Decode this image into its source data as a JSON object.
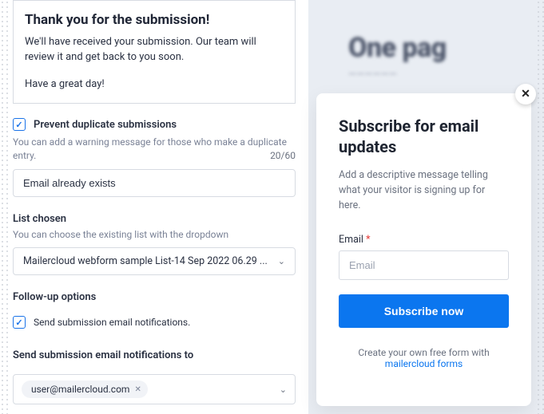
{
  "success_box": {
    "title": "Thank you for the submission!",
    "body": "We'll have received your submission. Our team will review it and get back to you soon.",
    "signoff": "Have a great day!"
  },
  "prevent": {
    "label": "Prevent duplicate submissions",
    "helper": "You can add a warning message for those who make a duplicate entry.",
    "counter": "20/60",
    "value": "Email already exists"
  },
  "list": {
    "title": "List chosen",
    "helper": "You can choose the existing list with the dropdown",
    "selected": "Mailercloud webform sample List-14 Sep 2022 06.29 ..."
  },
  "followup": {
    "title": "Follow-up options",
    "option": "Send submission email notifications."
  },
  "notify": {
    "title": "Send submission email notifications to",
    "tag": "user@mailercloud.com"
  },
  "preview": {
    "hero_title": "One pag",
    "hero_sub": "——————",
    "popup_title": "Subscribe for email updates",
    "popup_desc": "Add a descriptive message telling what your visitor is signing up for here.",
    "email_label": "Email",
    "email_placeholder": "Email",
    "button": "Subscribe now",
    "footer_text": "Create your own free form with",
    "footer_link": "mailercloud forms"
  }
}
